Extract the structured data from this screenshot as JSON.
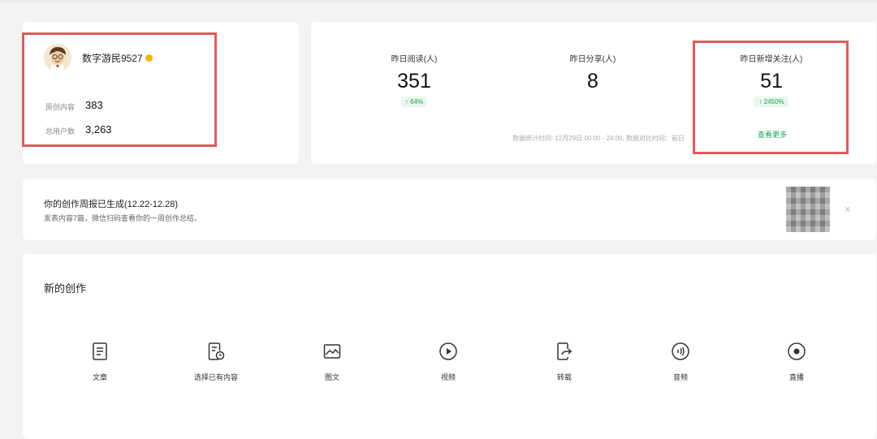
{
  "profile": {
    "username": "数字游民9527",
    "stats": [
      {
        "label": "原创内容",
        "value": "383"
      },
      {
        "label": "总用户数",
        "value": "3,263"
      }
    ]
  },
  "metrics": {
    "reads": {
      "label": "昨日阅读(人)",
      "value": "351",
      "change": "↑ 64%"
    },
    "shares": {
      "label": "昨日分享(人)",
      "value": "8"
    },
    "follows": {
      "label": "昨日新增关注(人)",
      "value": "51",
      "change": "↑ 2450%"
    },
    "footnote": "数据统计时间: 12月29日 00:00 - 24:00, 数据对比时间：前日",
    "see_more": "查看更多"
  },
  "banner": {
    "title": "你的创作周报已生成(12.22-12.28)",
    "subtitle": "发表内容7篇，微信扫码查看你的一周创作总结。",
    "close": "×"
  },
  "create": {
    "title": "新的创作",
    "tools": [
      {
        "label": "文章",
        "icon": "article-icon"
      },
      {
        "label": "选择已有内容",
        "icon": "existing-content-icon"
      },
      {
        "label": "图文",
        "icon": "image-text-icon"
      },
      {
        "label": "视频",
        "icon": "video-icon"
      },
      {
        "label": "转载",
        "icon": "repost-icon"
      },
      {
        "label": "音频",
        "icon": "audio-icon"
      },
      {
        "label": "直播",
        "icon": "live-icon"
      }
    ]
  },
  "colors": {
    "highlight": "#e25a5a",
    "green": "#17a34a",
    "verified": "#f5b400"
  }
}
